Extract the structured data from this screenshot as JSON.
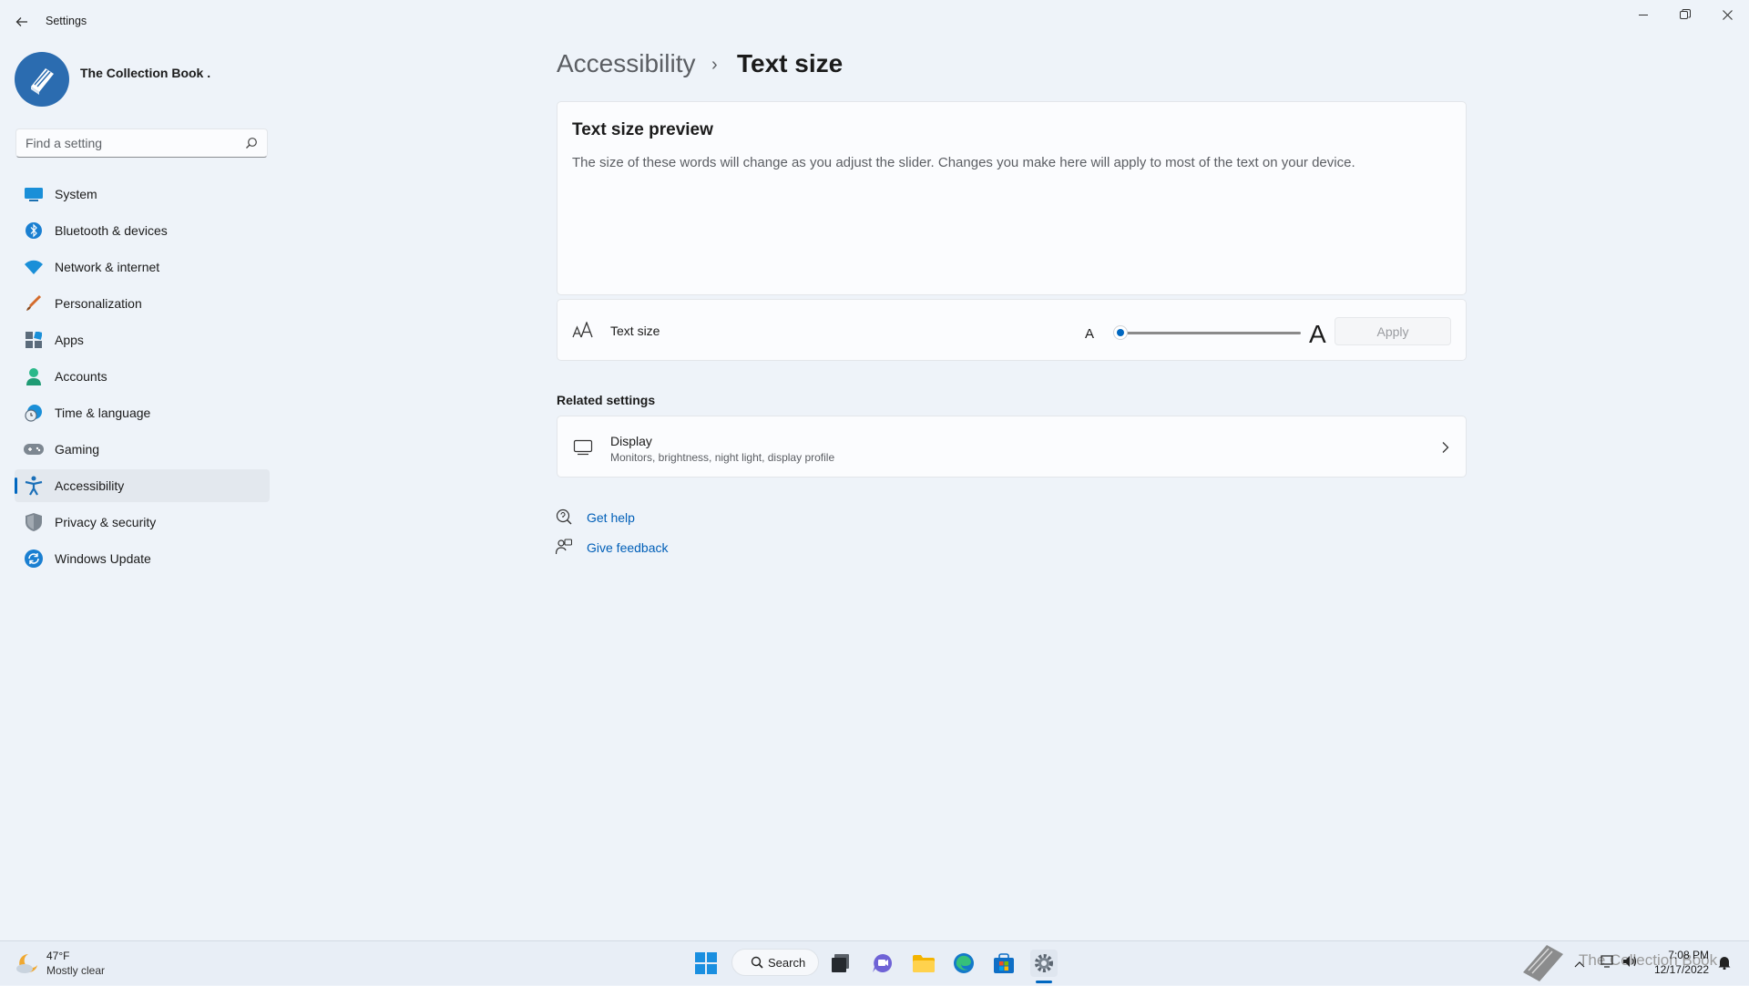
{
  "window": {
    "app_title": "Settings"
  },
  "profile": {
    "name": "The Collection Book ."
  },
  "search": {
    "placeholder": "Find a setting"
  },
  "sidebar": {
    "items": [
      {
        "label": "System",
        "icon": "monitor-icon"
      },
      {
        "label": "Bluetooth & devices",
        "icon": "bluetooth-icon"
      },
      {
        "label": "Network & internet",
        "icon": "wifi-icon"
      },
      {
        "label": "Personalization",
        "icon": "brush-icon"
      },
      {
        "label": "Apps",
        "icon": "apps-icon"
      },
      {
        "label": "Accounts",
        "icon": "person-icon"
      },
      {
        "label": "Time & language",
        "icon": "clock-globe-icon"
      },
      {
        "label": "Gaming",
        "icon": "gamepad-icon"
      },
      {
        "label": "Accessibility",
        "icon": "accessibility-icon",
        "active": true
      },
      {
        "label": "Privacy & security",
        "icon": "shield-icon"
      },
      {
        "label": "Windows Update",
        "icon": "update-icon"
      }
    ]
  },
  "breadcrumb": {
    "parent": "Accessibility",
    "separator": "›",
    "current": "Text size"
  },
  "preview": {
    "title": "Text size preview",
    "text": "The size of these words will change as you adjust the slider. Changes you make here will apply to most of the text on your device."
  },
  "text_size": {
    "label": "Text size",
    "slider_min_glyph": "A",
    "slider_max_glyph": "A",
    "slider_value_fraction": 0,
    "apply_label": "Apply"
  },
  "related": {
    "heading": "Related settings",
    "display_title": "Display",
    "display_subtitle": "Monitors, brightness, night light, display profile"
  },
  "help": {
    "get_help": "Get help",
    "give_feedback": "Give feedback"
  },
  "taskbar": {
    "weather_temp": "47°F",
    "weather_desc": "Mostly clear",
    "search_label": "Search",
    "time": "7:08 PM",
    "date": "12/17/2022",
    "watermark": "The Collection Book"
  },
  "colors": {
    "accent": "#0067c0",
    "link": "#005fb8",
    "background": "#eef3f9"
  }
}
